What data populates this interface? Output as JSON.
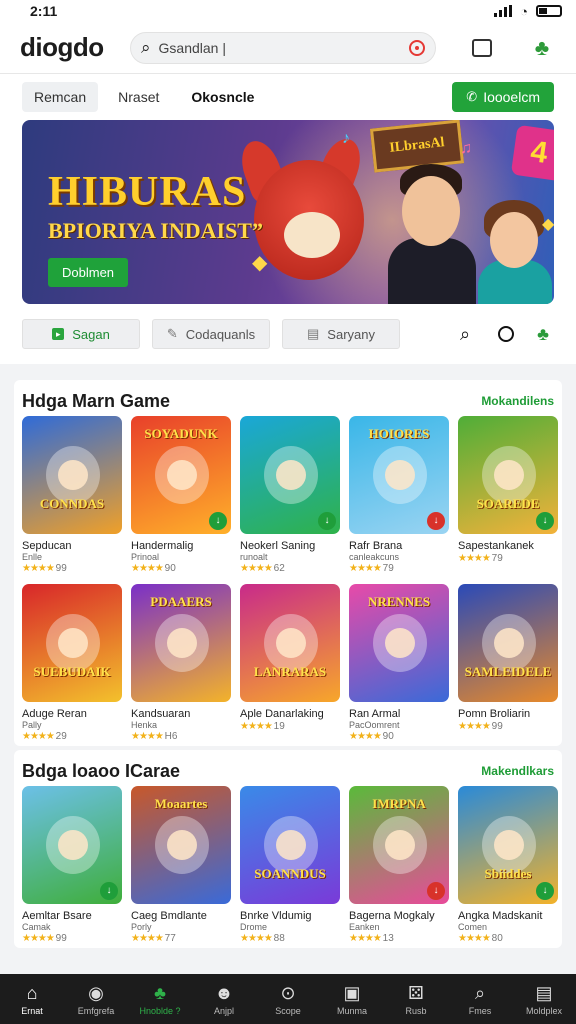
{
  "status": {
    "time": "2:11"
  },
  "header": {
    "logo": "diogdo",
    "search_placeholder": "Gsandlan |"
  },
  "tabs": {
    "items": [
      "Remcan",
      "Nraset",
      "Okosncle"
    ],
    "cta_label": "Ioooelcm"
  },
  "hero": {
    "title": "HIBURAS",
    "subtitle": "BPIORIYA INDAIST”",
    "button_label": "Doblmen",
    "sign": "ILbrasAl",
    "badge": "4"
  },
  "chips": [
    "Sagan",
    "Codaquanls",
    "Saryany"
  ],
  "sections": [
    {
      "title": "Hdga Marn Game",
      "more": "Mokandilens",
      "rows": [
        [
          {
            "art": "CONNDAS",
            "name": "Sepducan",
            "sub": "Enlle",
            "rating": "99",
            "color1": "#2f6bd8",
            "color2": "#f0a028",
            "badge": ""
          },
          {
            "art": "SOYADUNK",
            "name": "Handermalig",
            "sub": "Prinoal",
            "rating": "90",
            "color1": "#e8402a",
            "color2": "#ffb02a",
            "badge": "#1f9e3a"
          },
          {
            "art": "",
            "name": "Neokerl Saning",
            "sub": "runoalt",
            "rating": "62",
            "color1": "#1aa7d8",
            "color2": "#2fb24a",
            "badge": "#1f9e3a"
          },
          {
            "art": "HOIORES",
            "name": "Rafr Brana",
            "sub": "canleakcuns",
            "rating": "79",
            "color1": "#39b6e8",
            "color2": "#9ad4f2",
            "badge": "#d8322a"
          },
          {
            "art": "SOAREDE",
            "name": "Sapestankanek",
            "sub": "",
            "rating": "79",
            "color1": "#4fae38",
            "color2": "#f3b23a",
            "badge": "#1f9e3a"
          }
        ],
        [
          {
            "art": "SUEBUDAIK",
            "name": "Aduge Reran",
            "sub": "Pally",
            "rating": "29",
            "color1": "#d8262a",
            "color2": "#f3c12c",
            "badge": ""
          },
          {
            "art": "PDAAERS",
            "name": "Kandsuaran",
            "sub": "Henka",
            "rating": "H6",
            "color1": "#7a2fc8",
            "color2": "#f3b32a",
            "badge": ""
          },
          {
            "art": "LANRARAS",
            "name": "Aple Danarlaking",
            "sub": "",
            "rating": "19",
            "color1": "#c82a8a",
            "color2": "#f7a72a",
            "badge": ""
          },
          {
            "art": "NRENNES",
            "name": "Ran Armal",
            "sub": "PacOomrent",
            "rating": "90",
            "color1": "#e84aa8",
            "color2": "#3a6ad8",
            "badge": ""
          },
          {
            "art": "SAMLEIDELE",
            "name": "Pomn Broliarin",
            "sub": "",
            "rating": "99",
            "color1": "#2a4ab8",
            "color2": "#e88a2a",
            "badge": ""
          }
        ]
      ]
    },
    {
      "title": "Bdga loaoo ICarae",
      "more": "Makendlkars",
      "rows": [
        [
          {
            "art": "",
            "name": "Aemltar Bsare",
            "sub": "Camak",
            "rating": "99",
            "color1": "#6cc0e8",
            "color2": "#3fae3a",
            "badge": "#1f9e3a"
          },
          {
            "art": "Moaartes",
            "name": "Caeg Bmdlante",
            "sub": "Porly",
            "rating": "77",
            "color1": "#c8582a",
            "color2": "#3a6ad8",
            "badge": ""
          },
          {
            "art": "SOANNDUS",
            "name": "Bnrke Vldumig",
            "sub": "Drome",
            "rating": "88",
            "color1": "#3a8ae8",
            "color2": "#7a3ad8",
            "badge": ""
          },
          {
            "art": "IMRPNA",
            "name": "Bagerna Mogkaly",
            "sub": "Eanken",
            "rating": "13",
            "color1": "#5aba3a",
            "color2": "#e84a9a",
            "badge": "#d8322a"
          },
          {
            "art": "Sbiiddes",
            "name": "Angka Madskanit",
            "sub": "Comen",
            "rating": "80",
            "color1": "#2a8ad8",
            "color2": "#f3b22a",
            "badge": "#1f9e3a"
          }
        ]
      ]
    }
  ],
  "nav": [
    {
      "label": "Ernat",
      "icon": "home-icon",
      "glyph": "⌂",
      "state": "active"
    },
    {
      "label": "Emfgrefa",
      "icon": "gamepad-icon",
      "glyph": "◉",
      "state": ""
    },
    {
      "label": "Hnoblde ?",
      "icon": "clover-icon",
      "glyph": "♣",
      "state": "green"
    },
    {
      "label": "Anjpl",
      "icon": "mascot-icon",
      "glyph": "☻",
      "state": ""
    },
    {
      "label": "Scope",
      "icon": "pin-icon",
      "glyph": "⊙",
      "state": ""
    },
    {
      "label": "Munma",
      "icon": "box-icon",
      "glyph": "▣",
      "state": ""
    },
    {
      "label": "Rusb",
      "icon": "dice-icon",
      "glyph": "⚄",
      "state": ""
    },
    {
      "label": "Fmes",
      "icon": "search-icon",
      "glyph": "⌕",
      "state": ""
    },
    {
      "label": "Moldplex",
      "icon": "store-icon",
      "glyph": "▤",
      "state": ""
    }
  ]
}
